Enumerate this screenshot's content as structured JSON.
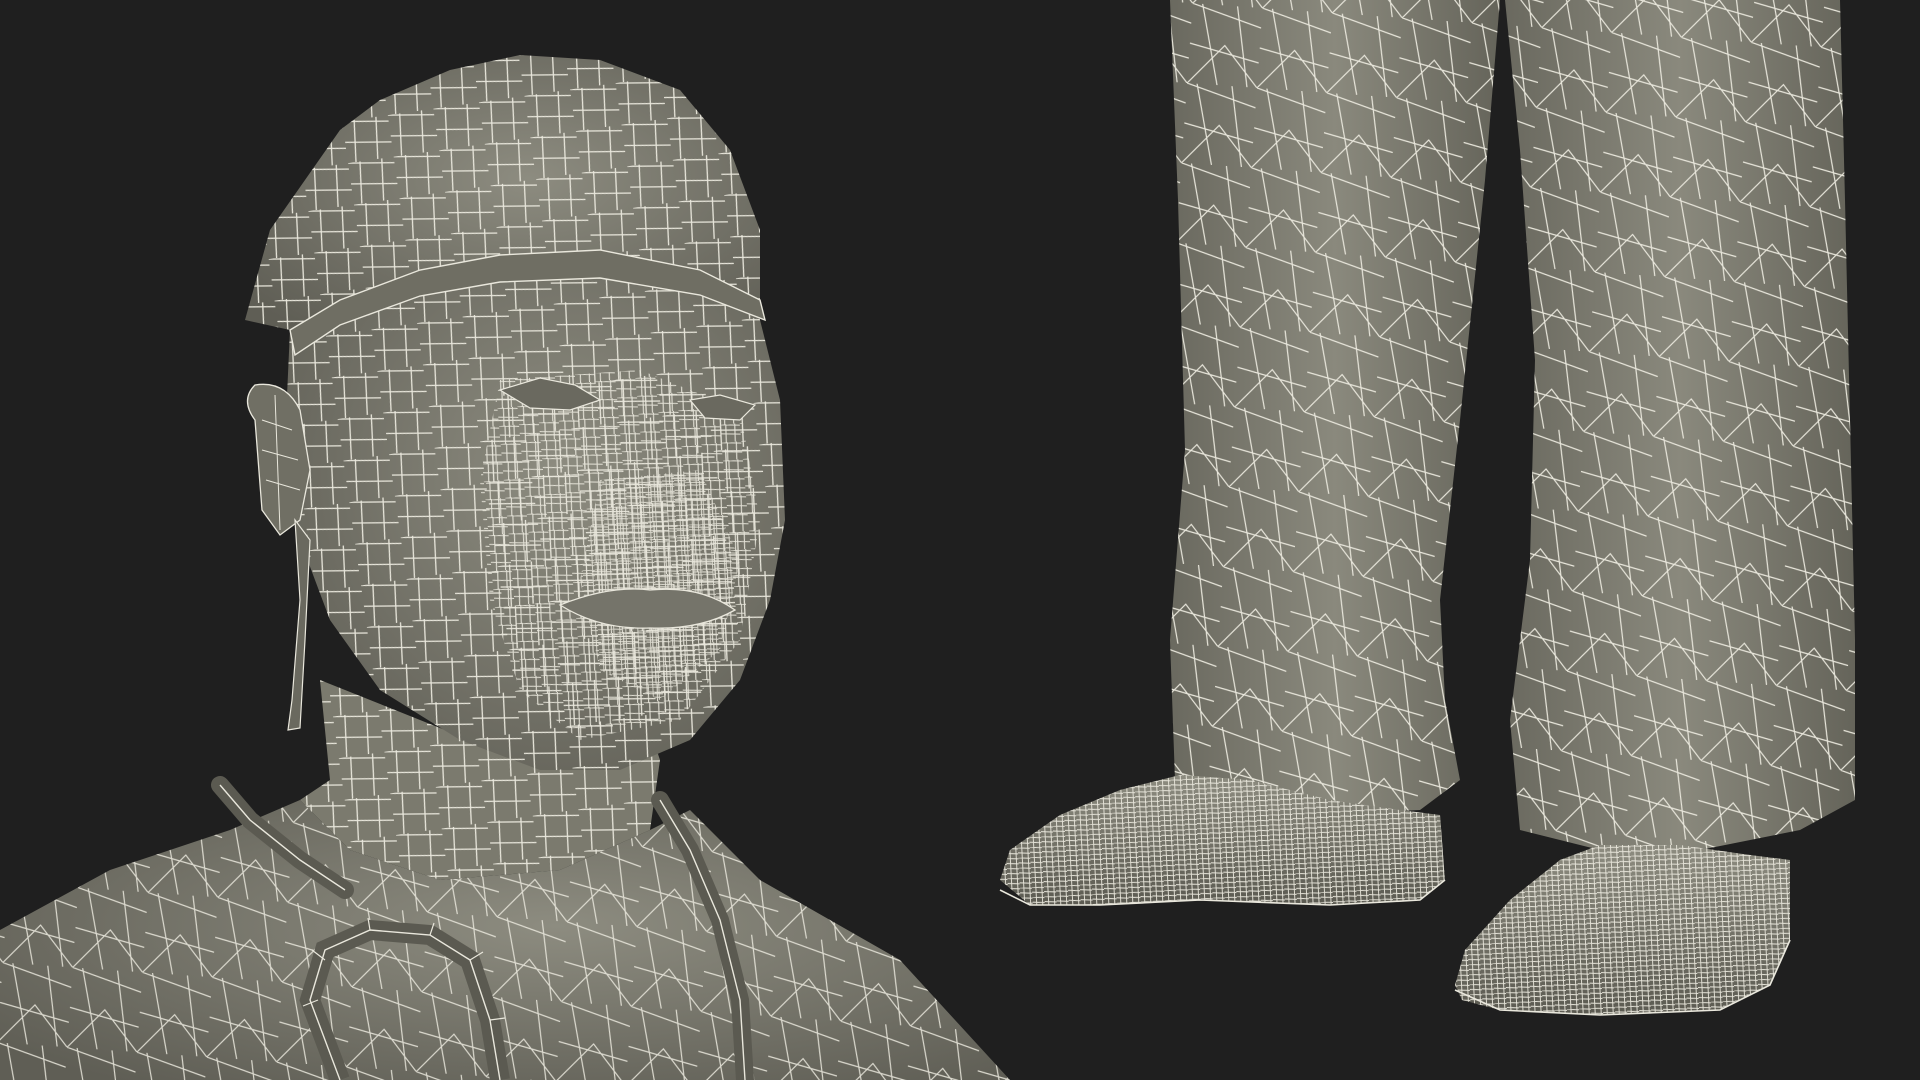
{
  "scene": {
    "background_color": "#1f1f1f",
    "mesh_fill_color": "#807f72",
    "mesh_shadow_color": "#5e5d53",
    "wire_color": "#e9e7dc"
  },
  "panels": [
    {
      "subject": "surgeon-head-wireframe"
    },
    {
      "subject": "surgeon-feet-wireframe"
    }
  ]
}
